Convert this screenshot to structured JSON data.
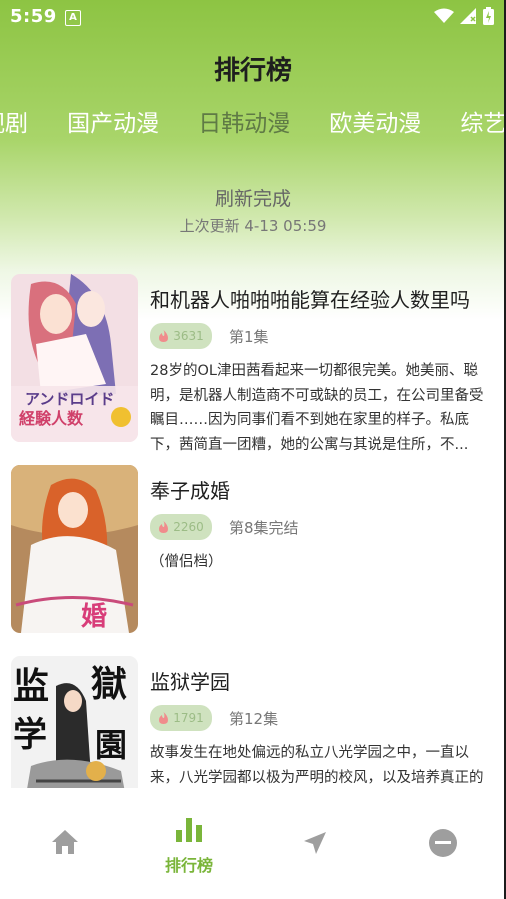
{
  "status": {
    "time": "5:59",
    "app_badge": "A"
  },
  "header": {
    "title": "排行榜"
  },
  "tabs": [
    {
      "label": "视剧"
    },
    {
      "label": "国产动漫"
    },
    {
      "label": "日韩动漫"
    },
    {
      "label": "欧美动漫"
    },
    {
      "label": "综艺"
    }
  ],
  "refresh": {
    "title": "刷新完成",
    "subtitle": "上次更新 4-13 05:59"
  },
  "items": [
    {
      "title": "和机器人啪啪啪能算在经验人数里吗",
      "heat": "3631",
      "episode": "第1集",
      "desc": "28岁的OL津田茜看起来一切都很完美。她美丽、聪明，是机器人制造商不可或缺的员工，在公司里备受瞩目……因为同事们看不到她在家里的样子。私底下，茜简直一团糟，她的公寓与其说是住所，不..."
    },
    {
      "title": "奉子成婚",
      "heat": "2260",
      "episode": "第8集完结",
      "desc": "（僧侣档）"
    },
    {
      "title": "监狱学园",
      "heat": "1791",
      "episode": "第12集",
      "desc": "故事发生在地处偏远的私立八光学园之中，一直以来，八光学园都以极为严明的校风，以及培养真正的淑女而闻名于世。"
    }
  ],
  "nav": {
    "rank_label": "排行榜"
  },
  "colors": {
    "accent": "#7ab53a",
    "header_green": "#8dc443",
    "heat_bg": "#cfe2bf"
  }
}
